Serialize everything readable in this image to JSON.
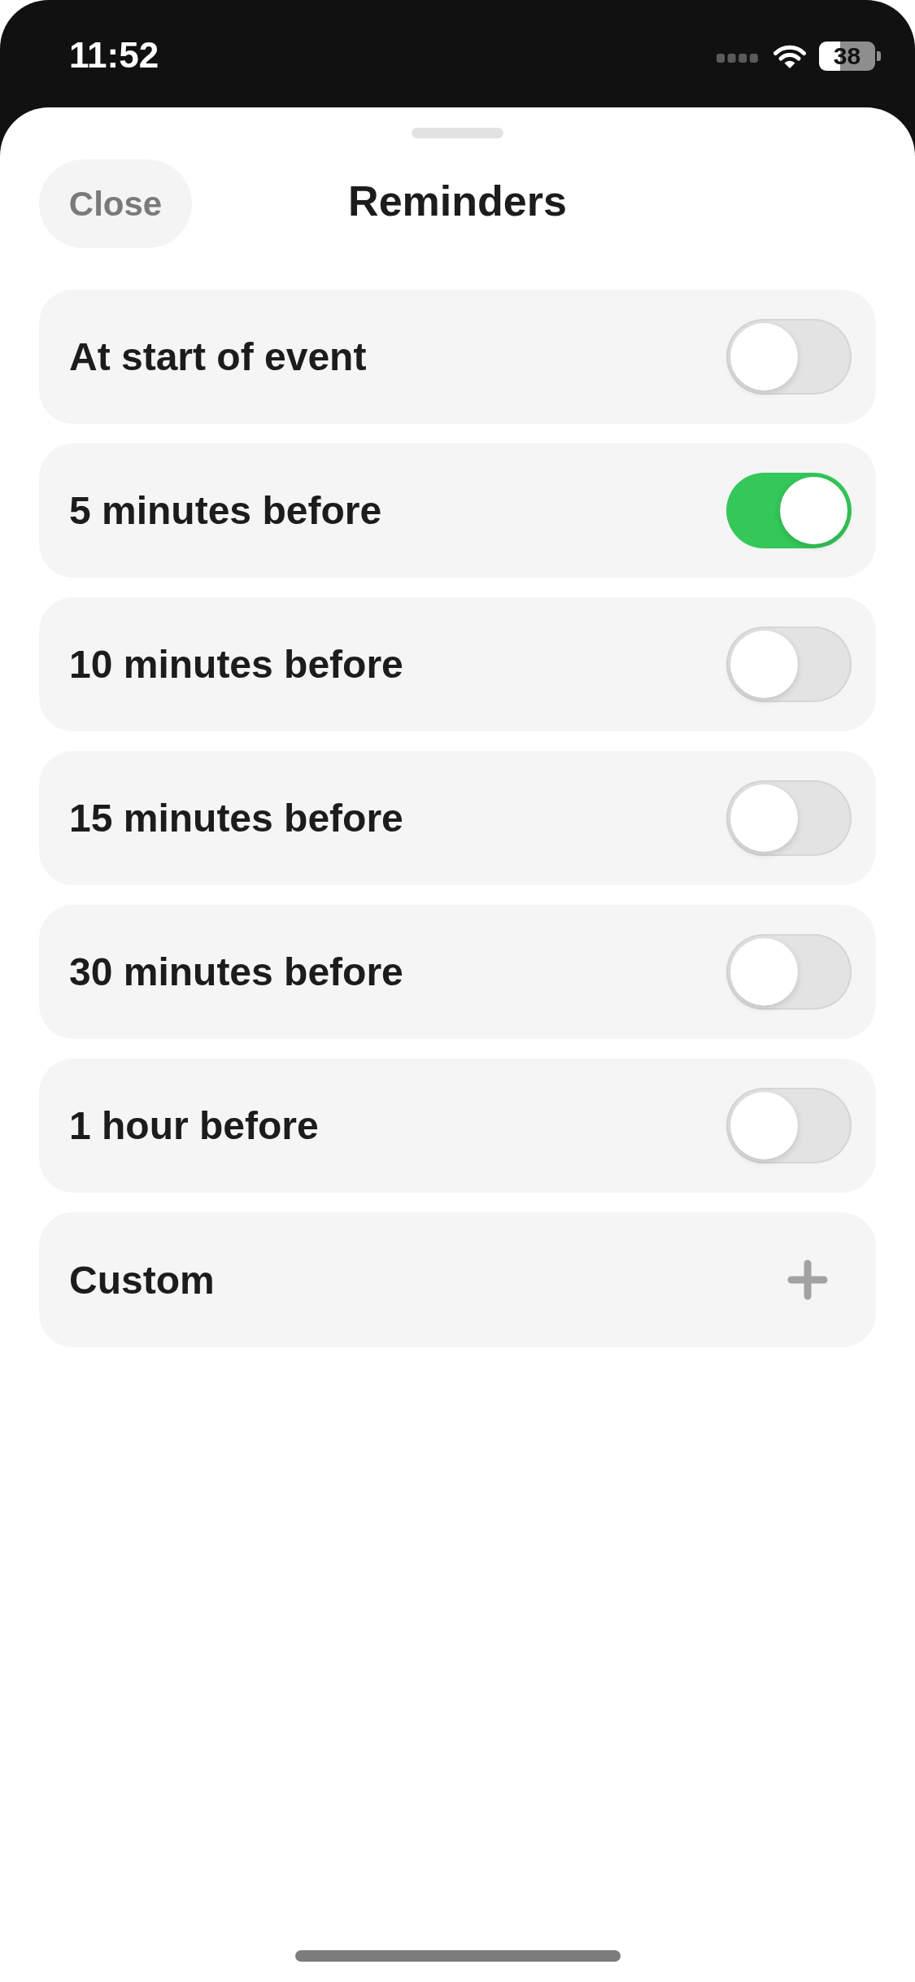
{
  "status_bar": {
    "time": "11:52",
    "battery": "38"
  },
  "header": {
    "close_button": "Close",
    "title": "Reminders"
  },
  "reminders": [
    {
      "label": "At start of event",
      "on": false
    },
    {
      "label": "5 minutes before",
      "on": true
    },
    {
      "label": "10 minutes before",
      "on": false
    },
    {
      "label": "15 minutes before",
      "on": false
    },
    {
      "label": "30 minutes before",
      "on": false
    },
    {
      "label": "1 hour before",
      "on": false
    }
  ],
  "custom": {
    "label": "Custom"
  }
}
